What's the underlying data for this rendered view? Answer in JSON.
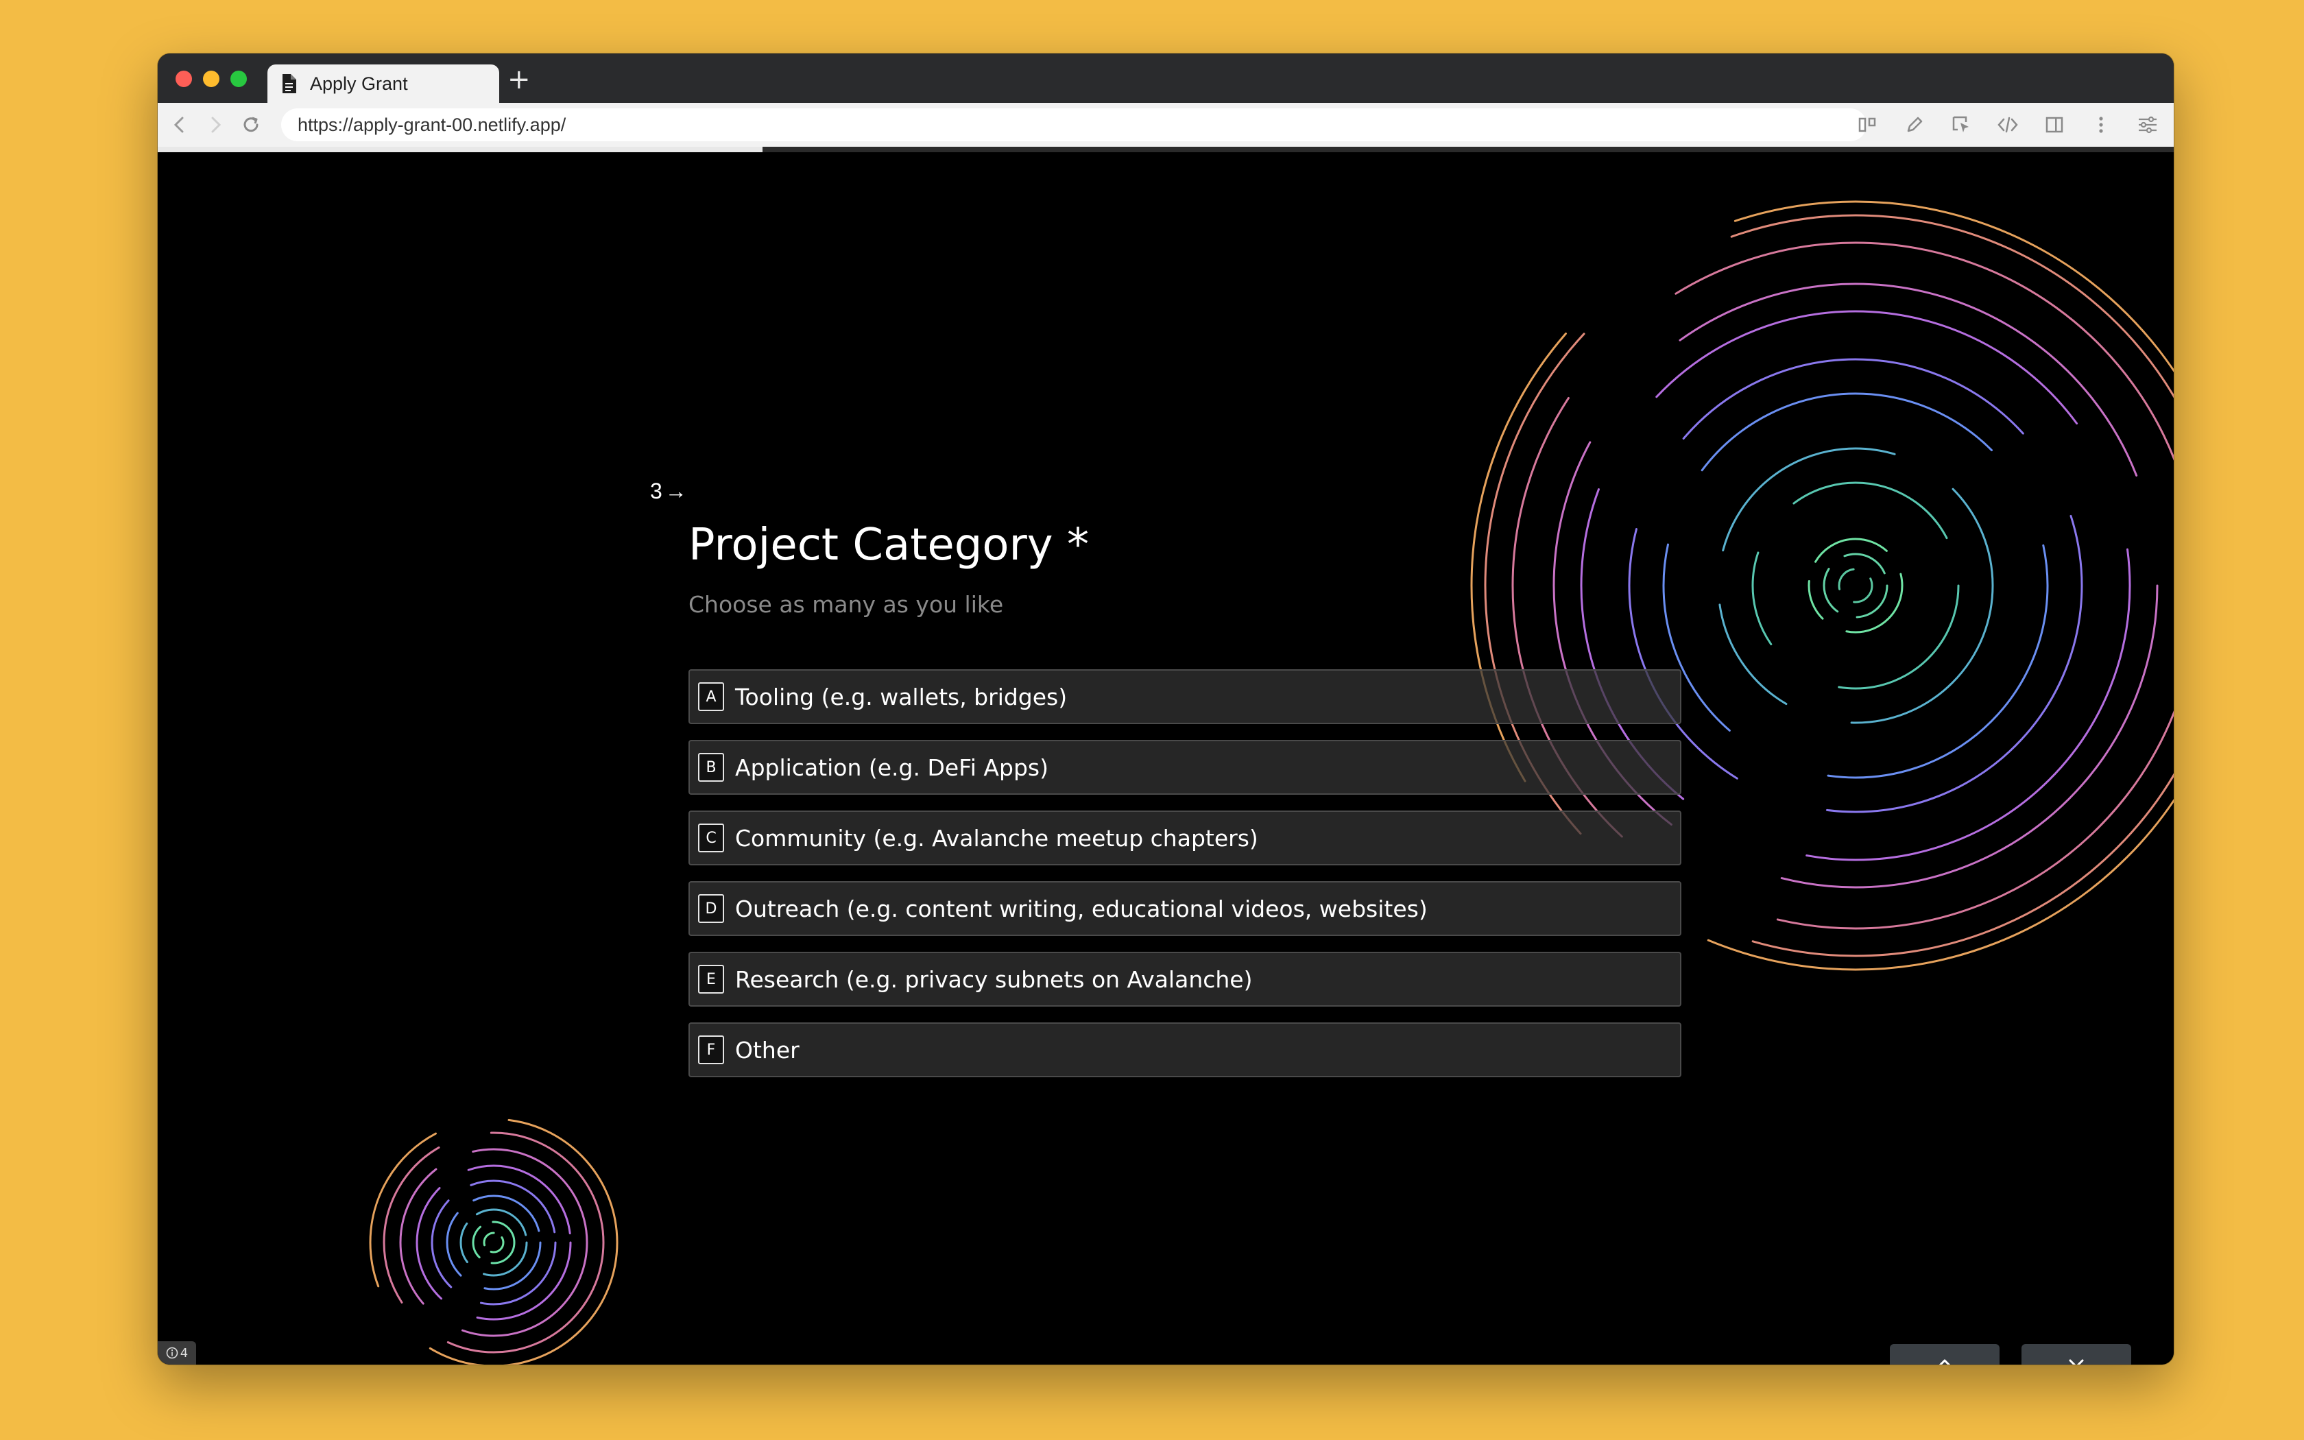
{
  "browser": {
    "tab_title": "Apply Grant",
    "new_tab_symbol": "+",
    "url": "https://apply-grant-00.netlify.app/"
  },
  "form": {
    "progress": 0.3,
    "question_number": "3",
    "question_arrow": "→",
    "title": "Project Category *",
    "subtitle": "Choose as many as you like",
    "options": [
      {
        "key": "A",
        "label": "Tooling (e.g. wallets, bridges)"
      },
      {
        "key": "B",
        "label": "Application (e.g. DeFi Apps)"
      },
      {
        "key": "C",
        "label": "Community (e.g. Avalanche meetup chapters)"
      },
      {
        "key": "D",
        "label": "Outreach (e.g. content writing, educational videos, websites)"
      },
      {
        "key": "E",
        "label": "Research (e.g. privacy subnets on Avalanche)"
      },
      {
        "key": "F",
        "label": "Other"
      }
    ]
  },
  "badge": {
    "count": "4"
  },
  "icons": {
    "tab": "document-icon",
    "back": "back-arrow-icon",
    "forward": "forward-arrow-icon",
    "reload": "reload-icon",
    "up": "chevron-double-up-icon",
    "down": "chevron-double-down-icon"
  }
}
